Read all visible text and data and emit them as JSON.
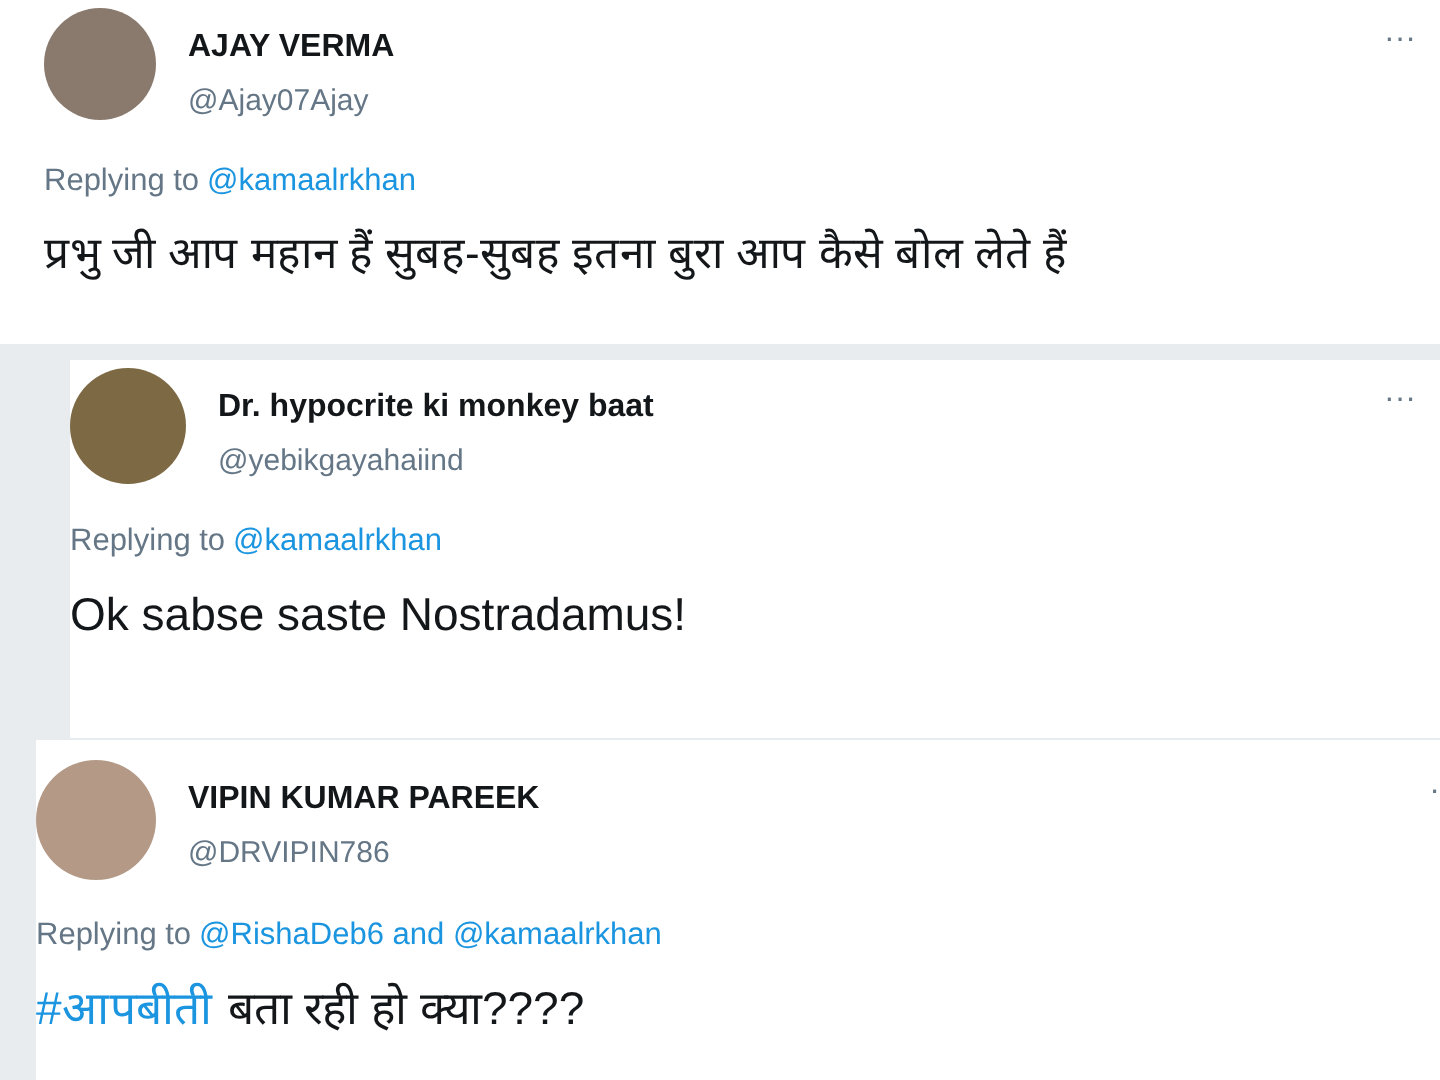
{
  "tweets": [
    {
      "name": "AJAY VERMA",
      "handle": "@Ajay07Ajay",
      "reply": [
        {
          "text": "Replying to",
          "link": false
        },
        {
          "text": "@kamaalrkhan",
          "link": true
        }
      ],
      "body": [
        {
          "text": "प्रभु जी आप महान हैं सुबह-सुबह इतना बुरा आप कैसे बोल लेते हैं",
          "link": false
        }
      ],
      "menu": "···"
    },
    {
      "name": "Dr. hypocrite ki monkey baat",
      "handle": "@yebikgayahaiind",
      "reply": [
        {
          "text": "Replying to",
          "link": false
        },
        {
          "text": "@kamaalrkhan",
          "link": true
        }
      ],
      "body": [
        {
          "text": "Ok sabse saste Nostradamus!",
          "link": false
        }
      ],
      "menu": "···"
    },
    {
      "name": "VIPIN KUMAR PAREEK",
      "handle": "@DRVIPIN786",
      "reply": [
        {
          "text": "Replying to",
          "link": false
        },
        {
          "text": "@RishaDeb6 and @kamaalrkhan",
          "link": true
        }
      ],
      "body": [
        {
          "text": "#आपबीती",
          "link": true
        },
        {
          "text": "बता रही हो क्या????",
          "link": false
        }
      ],
      "menu": "·"
    }
  ]
}
